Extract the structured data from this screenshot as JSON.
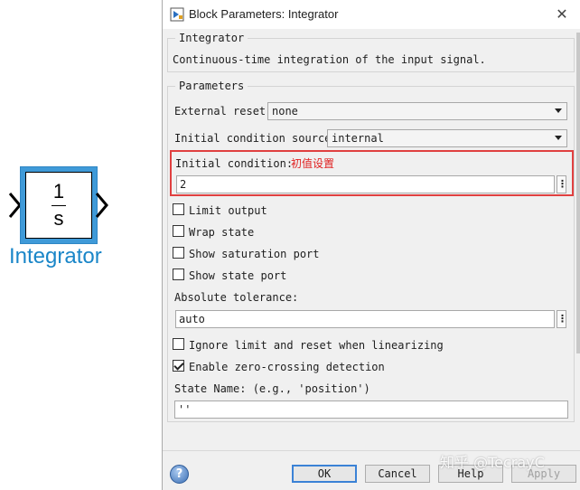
{
  "block": {
    "numerator": "1",
    "denominator": "s",
    "label": "Integrator",
    "highlight_color": "#3f9ad8",
    "label_color": "#1a86c8"
  },
  "dialog": {
    "title": "Block Parameters: Integrator",
    "close_icon": "close-icon",
    "description_group": {
      "legend": "Integrator",
      "text": "Continuous-time integration of the input signal."
    },
    "parameters": {
      "legend": "Parameters",
      "external_reset_label": "External reset:",
      "external_reset_value": "none",
      "ic_source_label": "Initial condition source:",
      "ic_source_value": "internal",
      "ic_label": "Initial condition:",
      "ic_note": "初值设置",
      "ic_value": "2",
      "limit_output": {
        "label": "Limit output",
        "checked": false
      },
      "wrap_state": {
        "label": "Wrap state",
        "checked": false
      },
      "show_saturation": {
        "label": "Show saturation port",
        "checked": false
      },
      "show_state": {
        "label": "Show state port",
        "checked": false
      },
      "abs_tol_label": "Absolute tolerance:",
      "abs_tol_value": "auto",
      "ignore_limit": {
        "label": "Ignore limit and reset when linearizing",
        "checked": false
      },
      "zero_crossing": {
        "label": "Enable zero-crossing detection",
        "checked": true
      },
      "state_name_label": "State Name: (e.g., 'position')",
      "state_name_value": "''"
    },
    "buttons": {
      "ok": "OK",
      "cancel": "Cancel",
      "help": "Help",
      "apply": "Apply"
    },
    "help_icon": "?",
    "watermark": "知乎 @TecrayC",
    "highlight_color": "#e04040"
  }
}
